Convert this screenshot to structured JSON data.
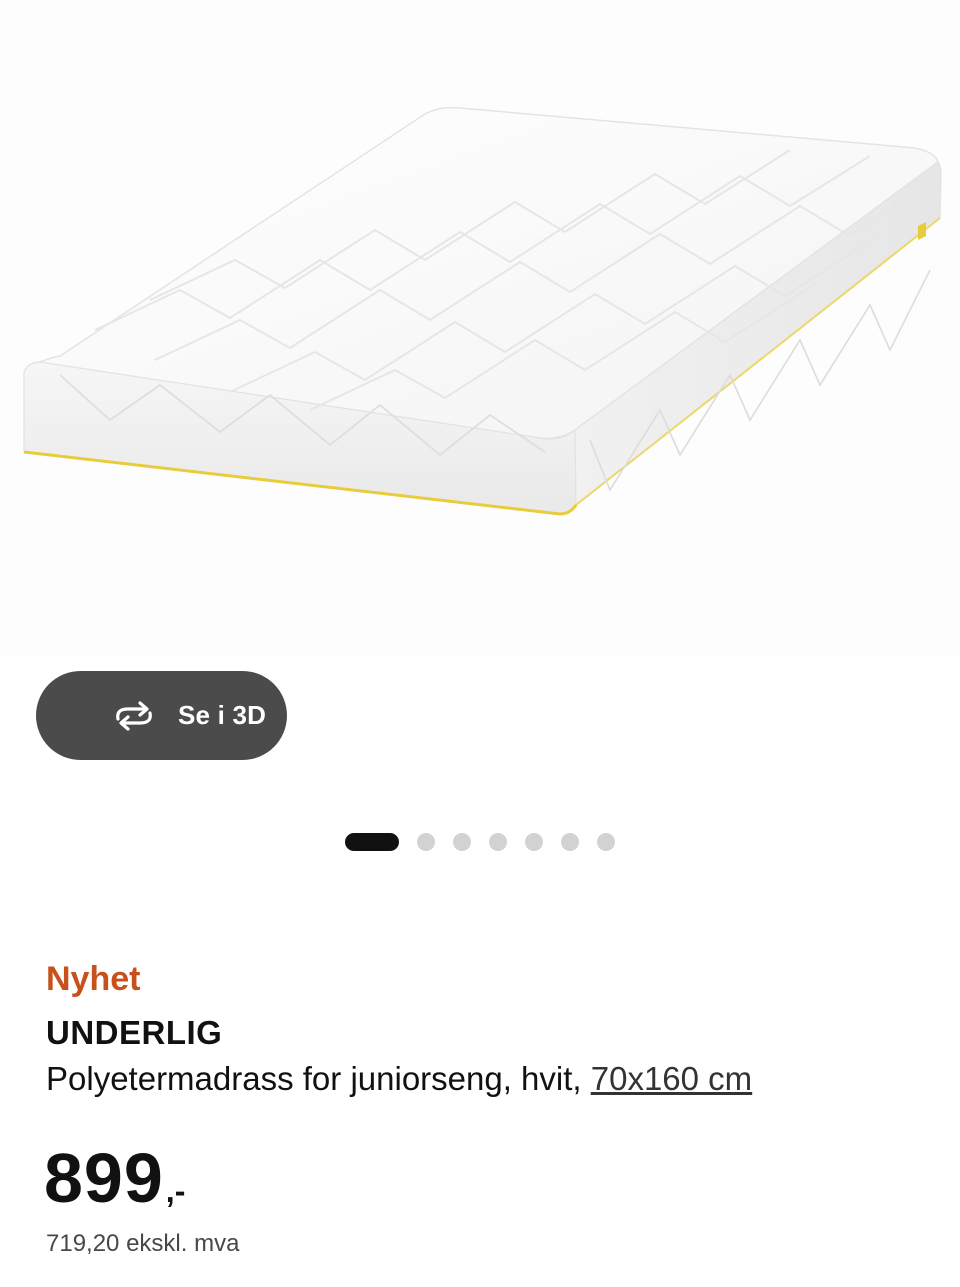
{
  "gallery": {
    "view_3d_label": "Se i 3D",
    "view_3d_icon": "rotate-arrows-icon",
    "dots_total": 7,
    "active_index": 0
  },
  "product": {
    "badge": "Nyhet",
    "name": "UNDERLIG",
    "description": "Polyetermadrass for juniorseng, hvit, ",
    "size": "70x160 cm",
    "price": "899",
    "price_suffix": ",-",
    "price_ex_vat": "719,20 ekskl. mva"
  },
  "colors": {
    "badge_new": "#c8501a",
    "button_bg": "#4b4b4b",
    "dot_active": "#111111",
    "dot_inactive": "#d2d2d2",
    "mattress_edge_accent": "#e8cc3c"
  }
}
